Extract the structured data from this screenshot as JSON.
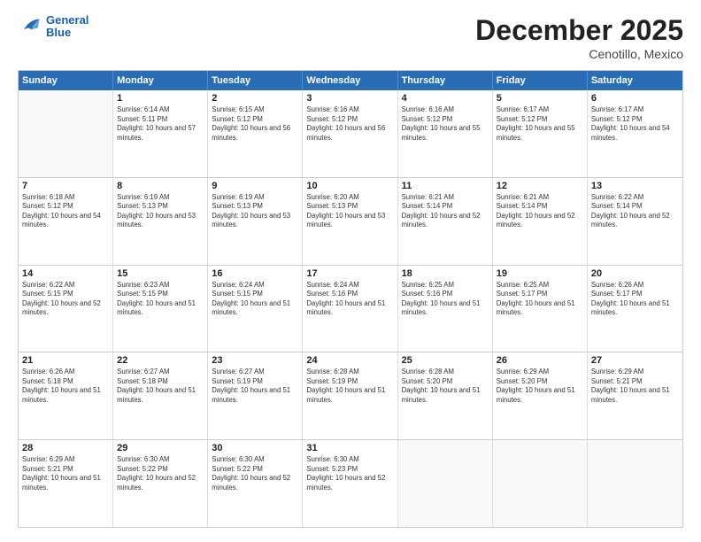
{
  "logo": {
    "line1": "General",
    "line2": "Blue"
  },
  "title": "December 2025",
  "subtitle": "Cenotillo, Mexico",
  "days_of_week": [
    "Sunday",
    "Monday",
    "Tuesday",
    "Wednesday",
    "Thursday",
    "Friday",
    "Saturday"
  ],
  "weeks": [
    [
      {
        "day": "",
        "empty": true
      },
      {
        "day": "1",
        "sunrise": "6:14 AM",
        "sunset": "5:11 PM",
        "daylight": "10 hours and 57 minutes."
      },
      {
        "day": "2",
        "sunrise": "6:15 AM",
        "sunset": "5:12 PM",
        "daylight": "10 hours and 56 minutes."
      },
      {
        "day": "3",
        "sunrise": "6:16 AM",
        "sunset": "5:12 PM",
        "daylight": "10 hours and 56 minutes."
      },
      {
        "day": "4",
        "sunrise": "6:16 AM",
        "sunset": "5:12 PM",
        "daylight": "10 hours and 55 minutes."
      },
      {
        "day": "5",
        "sunrise": "6:17 AM",
        "sunset": "5:12 PM",
        "daylight": "10 hours and 55 minutes."
      },
      {
        "day": "6",
        "sunrise": "6:17 AM",
        "sunset": "5:12 PM",
        "daylight": "10 hours and 54 minutes."
      }
    ],
    [
      {
        "day": "7",
        "sunrise": "6:18 AM",
        "sunset": "5:12 PM",
        "daylight": "10 hours and 54 minutes."
      },
      {
        "day": "8",
        "sunrise": "6:19 AM",
        "sunset": "5:13 PM",
        "daylight": "10 hours and 53 minutes."
      },
      {
        "day": "9",
        "sunrise": "6:19 AM",
        "sunset": "5:13 PM",
        "daylight": "10 hours and 53 minutes."
      },
      {
        "day": "10",
        "sunrise": "6:20 AM",
        "sunset": "5:13 PM",
        "daylight": "10 hours and 53 minutes."
      },
      {
        "day": "11",
        "sunrise": "6:21 AM",
        "sunset": "5:14 PM",
        "daylight": "10 hours and 52 minutes."
      },
      {
        "day": "12",
        "sunrise": "6:21 AM",
        "sunset": "5:14 PM",
        "daylight": "10 hours and 52 minutes."
      },
      {
        "day": "13",
        "sunrise": "6:22 AM",
        "sunset": "5:14 PM",
        "daylight": "10 hours and 52 minutes."
      }
    ],
    [
      {
        "day": "14",
        "sunrise": "6:22 AM",
        "sunset": "5:15 PM",
        "daylight": "10 hours and 52 minutes."
      },
      {
        "day": "15",
        "sunrise": "6:23 AM",
        "sunset": "5:15 PM",
        "daylight": "10 hours and 51 minutes."
      },
      {
        "day": "16",
        "sunrise": "6:24 AM",
        "sunset": "5:15 PM",
        "daylight": "10 hours and 51 minutes."
      },
      {
        "day": "17",
        "sunrise": "6:24 AM",
        "sunset": "5:16 PM",
        "daylight": "10 hours and 51 minutes."
      },
      {
        "day": "18",
        "sunrise": "6:25 AM",
        "sunset": "5:16 PM",
        "daylight": "10 hours and 51 minutes."
      },
      {
        "day": "19",
        "sunrise": "6:25 AM",
        "sunset": "5:17 PM",
        "daylight": "10 hours and 51 minutes."
      },
      {
        "day": "20",
        "sunrise": "6:26 AM",
        "sunset": "5:17 PM",
        "daylight": "10 hours and 51 minutes."
      }
    ],
    [
      {
        "day": "21",
        "sunrise": "6:26 AM",
        "sunset": "5:18 PM",
        "daylight": "10 hours and 51 minutes."
      },
      {
        "day": "22",
        "sunrise": "6:27 AM",
        "sunset": "5:18 PM",
        "daylight": "10 hours and 51 minutes."
      },
      {
        "day": "23",
        "sunrise": "6:27 AM",
        "sunset": "5:19 PM",
        "daylight": "10 hours and 51 minutes."
      },
      {
        "day": "24",
        "sunrise": "6:28 AM",
        "sunset": "5:19 PM",
        "daylight": "10 hours and 51 minutes."
      },
      {
        "day": "25",
        "sunrise": "6:28 AM",
        "sunset": "5:20 PM",
        "daylight": "10 hours and 51 minutes."
      },
      {
        "day": "26",
        "sunrise": "6:29 AM",
        "sunset": "5:20 PM",
        "daylight": "10 hours and 51 minutes."
      },
      {
        "day": "27",
        "sunrise": "6:29 AM",
        "sunset": "5:21 PM",
        "daylight": "10 hours and 51 minutes."
      }
    ],
    [
      {
        "day": "28",
        "sunrise": "6:29 AM",
        "sunset": "5:21 PM",
        "daylight": "10 hours and 51 minutes."
      },
      {
        "day": "29",
        "sunrise": "6:30 AM",
        "sunset": "5:22 PM",
        "daylight": "10 hours and 52 minutes."
      },
      {
        "day": "30",
        "sunrise": "6:30 AM",
        "sunset": "5:22 PM",
        "daylight": "10 hours and 52 minutes."
      },
      {
        "day": "31",
        "sunrise": "6:30 AM",
        "sunset": "5:23 PM",
        "daylight": "10 hours and 52 minutes."
      },
      {
        "day": "",
        "empty": true
      },
      {
        "day": "",
        "empty": true
      },
      {
        "day": "",
        "empty": true
      }
    ]
  ]
}
